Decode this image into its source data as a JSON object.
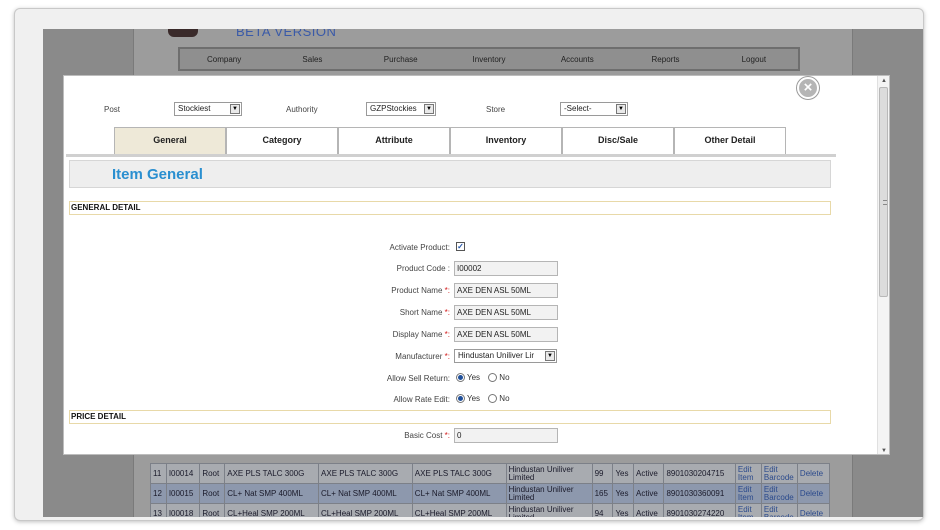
{
  "background": {
    "beta_label": "BETA VERSION",
    "nav": [
      "Company",
      "Sales",
      "Purchase",
      "Inventory",
      "Accounts",
      "Reports",
      "Logout"
    ],
    "rows": [
      {
        "no": "11",
        "code": "I00014",
        "group": "Root",
        "name": "AXE PLS TALC 300G",
        "short": "AXE PLS TALC 300G",
        "display": "AXE PLS TALC 300G",
        "mfr": "Hindustan Uniliver Limited",
        "stock": "99",
        "sell": "Yes",
        "status": "Active",
        "barcode": "8901030204715",
        "edit": "Edit Item",
        "edit_barcode": "Edit Barcode",
        "delete": "Delete"
      },
      {
        "no": "12",
        "code": "I00015",
        "group": "Root",
        "name": "CL+ Nat SMP 400ML",
        "short": "CL+ Nat SMP 400ML",
        "display": "CL+ Nat SMP 400ML",
        "mfr": "Hindustan Uniliver Limited",
        "stock": "165",
        "sell": "Yes",
        "status": "Active",
        "barcode": "8901030360091",
        "edit": "Edit Item",
        "edit_barcode": "Edit Barcode",
        "delete": "Delete"
      },
      {
        "no": "13",
        "code": "I00018",
        "group": "Root",
        "name": "CL+Heal SMP 200ML",
        "short": "CL+Heal SMP 200ML",
        "display": "CL+Heal SMP 200ML",
        "mfr": "Hindustan Uniliver Limited",
        "stock": "94",
        "sell": "Yes",
        "status": "Active",
        "barcode": "8901030274220",
        "edit": "Edit Item",
        "edit_barcode": "Edit Barcode",
        "delete": "Delete"
      }
    ]
  },
  "modal": {
    "filters": {
      "post_label": "Post",
      "post_value": "Stockiest",
      "authority_label": "Authority",
      "authority_value": "GZPStockies",
      "store_label": "Store",
      "store_value": "-Select-"
    },
    "tabs": [
      "General",
      "Category",
      "Attribute",
      "Inventory",
      "Disc/Sale",
      "Other Detail"
    ],
    "active_tab": "General",
    "section_title": "Item General",
    "general_detail_label": "GENERAL DETAIL",
    "price_detail_label": "PRICE DETAIL",
    "fields": {
      "activate_label": "Activate Product:",
      "activate_checked": true,
      "product_code_label": "Product Code :",
      "product_code": "I00002",
      "product_name_label": "Product Name",
      "product_name": "AXE DEN ASL 50ML",
      "short_name_label": "Short Name",
      "short_name": "AXE DEN ASL 50ML",
      "display_name_label": "Display Name",
      "display_name": "AXE DEN ASL 50ML",
      "manufacturer_label": "Manufacturer",
      "manufacturer": "Hindustan Uniliver Lir",
      "allow_sell_return_label": "Allow Sell Return:",
      "allow_rate_edit_label": "Allow Rate Edit:",
      "yes_label": "Yes",
      "no_label": "No",
      "basic_cost_label": "Basic Cost",
      "basic_cost": "0",
      "required_mark": "*:"
    }
  },
  "colors": {
    "accent_title": "#2a8fd0",
    "active_tab_bg": "#eee9d8",
    "required": "#d21a1a"
  }
}
